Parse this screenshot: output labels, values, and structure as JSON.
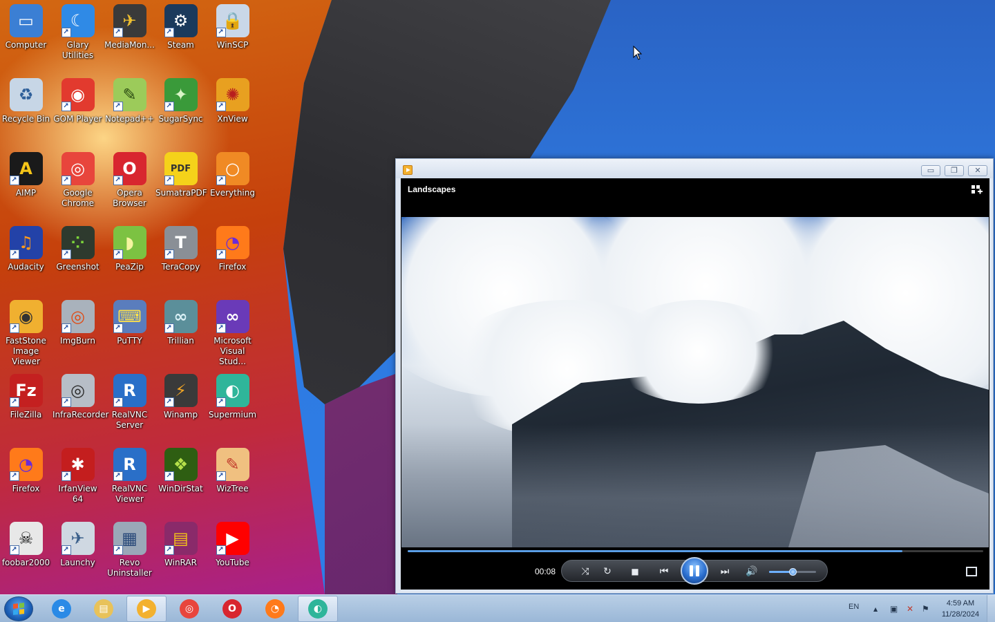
{
  "desktop": {
    "icons": [
      {
        "label": "Computer",
        "glyph": "▭",
        "bg": "#3b7fd4",
        "fg": "#ffffff"
      },
      {
        "label": "Glary Utilities",
        "glyph": "☾",
        "bg": "#2f8ae6",
        "fg": "#ffffff"
      },
      {
        "label": "MediaMon...",
        "glyph": "✈",
        "bg": "#3a3a3a",
        "fg": "#f0c030"
      },
      {
        "label": "Steam",
        "glyph": "⚙",
        "bg": "#1b3a5c",
        "fg": "#ffffff"
      },
      {
        "label": "WinSCP",
        "glyph": "🔒",
        "bg": "#c9d7e8",
        "fg": "#2f7a3a"
      },
      {
        "label": "Recycle Bin",
        "glyph": "♻",
        "bg": "#c7d6e6",
        "fg": "#2e5f9a"
      },
      {
        "label": "GOM Player",
        "glyph": "◉",
        "bg": "#e23a2e",
        "fg": "#ffffff"
      },
      {
        "label": "Notepad++",
        "glyph": "✎",
        "bg": "#9ccb5a",
        "fg": "#2a4a12"
      },
      {
        "label": "SugarSync",
        "glyph": "✦",
        "bg": "#3a9a3a",
        "fg": "#d9f5c8"
      },
      {
        "label": "XnView",
        "glyph": "✺",
        "bg": "#e8a020",
        "fg": "#b81e1e"
      },
      {
        "label": "AIMP",
        "glyph": "A",
        "bg": "#1a1a1a",
        "fg": "#f5c518"
      },
      {
        "label": "Google Chrome",
        "glyph": "◎",
        "bg": "#e8453c",
        "fg": "#ffffff"
      },
      {
        "label": "Opera Browser",
        "glyph": "O",
        "bg": "#d8262f",
        "fg": "#ffffff"
      },
      {
        "label": "SumatraPDF",
        "glyph": "PDF",
        "bg": "#f5d21a",
        "fg": "#333333"
      },
      {
        "label": "Everything",
        "glyph": "○",
        "bg": "#f08a24",
        "fg": "#ffffff"
      },
      {
        "label": "Audacity",
        "glyph": "♫",
        "bg": "#2342a8",
        "fg": "#ff9a1a"
      },
      {
        "label": "Greenshot",
        "glyph": "⁘",
        "bg": "#2e3a2e",
        "fg": "#7cd43a"
      },
      {
        "label": "PeaZip",
        "glyph": "◗",
        "bg": "#7cc242",
        "fg": "#f5f5a0"
      },
      {
        "label": "TeraCopy",
        "glyph": "T",
        "bg": "#8a8f96",
        "fg": "#ffffff"
      },
      {
        "label": "Firefox",
        "glyph": "◔",
        "bg": "#ff7a1a",
        "fg": "#6a2bd8"
      },
      {
        "label": "FastStone Image Viewer",
        "glyph": "◉",
        "bg": "#f0b030",
        "fg": "#333333"
      },
      {
        "label": "ImgBurn",
        "glyph": "◎",
        "bg": "#a9b2bc",
        "fg": "#e04a14"
      },
      {
        "label": "PuTTY",
        "glyph": "⌨",
        "bg": "#5a7dbd",
        "fg": "#ffe14a"
      },
      {
        "label": "Trillian",
        "glyph": "∞",
        "bg": "#5b8f9a",
        "fg": "#d9f0f5"
      },
      {
        "label": "Microsoft Visual Stud...",
        "glyph": "∞",
        "bg": "#6a3ab8",
        "fg": "#ffffff"
      },
      {
        "label": "FileZilla",
        "glyph": "Fz",
        "bg": "#c42020",
        "fg": "#ffffff"
      },
      {
        "label": "InfraRecorder",
        "glyph": "◎",
        "bg": "#b7bec7",
        "fg": "#2a2a2a"
      },
      {
        "label": "RealVNC Server",
        "glyph": "R",
        "bg": "#2a6fc8",
        "fg": "#ffffff"
      },
      {
        "label": "Winamp",
        "glyph": "⚡",
        "bg": "#3a3a3a",
        "fg": "#f5a623"
      },
      {
        "label": "Supermium",
        "glyph": "◐",
        "bg": "#2fb59a",
        "fg": "#ffffff"
      },
      {
        "label": "Firefox",
        "glyph": "◔",
        "bg": "#ff7a1a",
        "fg": "#6a2bd8"
      },
      {
        "label": "IrfanView 64",
        "glyph": "✱",
        "bg": "#c41e1e",
        "fg": "#ffffff"
      },
      {
        "label": "RealVNC Viewer",
        "glyph": "R",
        "bg": "#2a6fc8",
        "fg": "#ffffff"
      },
      {
        "label": "WinDirStat",
        "glyph": "❖",
        "bg": "#2e5e12",
        "fg": "#b5e04a"
      },
      {
        "label": "WizTree",
        "glyph": "✎",
        "bg": "#f0c080",
        "fg": "#c0392b"
      },
      {
        "label": "foobar2000",
        "glyph": "☠",
        "bg": "#e8e8e8",
        "fg": "#111111"
      },
      {
        "label": "Launchy",
        "glyph": "✈",
        "bg": "#cfd8e2",
        "fg": "#3a5f8a"
      },
      {
        "label": "Revo Uninstaller",
        "glyph": "▦",
        "bg": "#9aa8b8",
        "fg": "#2a4a7a"
      },
      {
        "label": "WinRAR",
        "glyph": "▤",
        "bg": "#8a2a6a",
        "fg": "#f5c518"
      },
      {
        "label": "YouTube",
        "glyph": "▶",
        "bg": "#ff0000",
        "fg": "#ffffff"
      }
    ]
  },
  "player": {
    "video_title": "Landscapes",
    "elapsed": "00:08",
    "progress_fraction": 0.86,
    "volume_fraction": 0.5,
    "icons": {
      "app": "media-player-icon",
      "minimize": "minimize-icon",
      "restore": "restore-icon",
      "close": "close-icon",
      "switch_view": "switch-to-library-icon",
      "shuffle": "shuffle-icon",
      "repeat": "repeat-icon",
      "stop": "stop-icon",
      "previous": "previous-icon",
      "pause": "pause-icon",
      "next": "next-icon",
      "mute": "volume-icon",
      "fullscreen": "fullscreen-icon"
    },
    "window_buttons": {
      "minimize": "▭",
      "restore": "❐",
      "close": "✕"
    },
    "control_glyphs": {
      "shuffle": "⤨",
      "repeat": "↻",
      "stop": "■",
      "previous": "⏮",
      "next": "⏭",
      "volume": "🔊"
    }
  },
  "taskbar": {
    "pinned": [
      {
        "name": "taskbar-internet-explorer",
        "glyph": "e",
        "bg": "#2a8ae6",
        "active": false
      },
      {
        "name": "taskbar-file-explorer",
        "glyph": "▤",
        "bg": "#e8c25a",
        "active": false
      },
      {
        "name": "taskbar-media-player",
        "glyph": "▶",
        "bg": "#f3b12f",
        "active": true
      },
      {
        "name": "taskbar-google-chrome",
        "glyph": "◎",
        "bg": "#e8453c",
        "active": false
      },
      {
        "name": "taskbar-opera",
        "glyph": "O",
        "bg": "#d8262f",
        "active": false
      },
      {
        "name": "taskbar-firefox",
        "glyph": "◔",
        "bg": "#ff7a1a",
        "active": false
      },
      {
        "name": "taskbar-supermium",
        "glyph": "◐",
        "bg": "#2fb59a",
        "active": true
      }
    ],
    "language": "EN",
    "tray_glyphs": {
      "show_hidden": "▲",
      "network": "▣",
      "volume_muted": "✕",
      "flag": "⚑"
    },
    "time": "4:59 AM",
    "date": "11/28/2024"
  }
}
